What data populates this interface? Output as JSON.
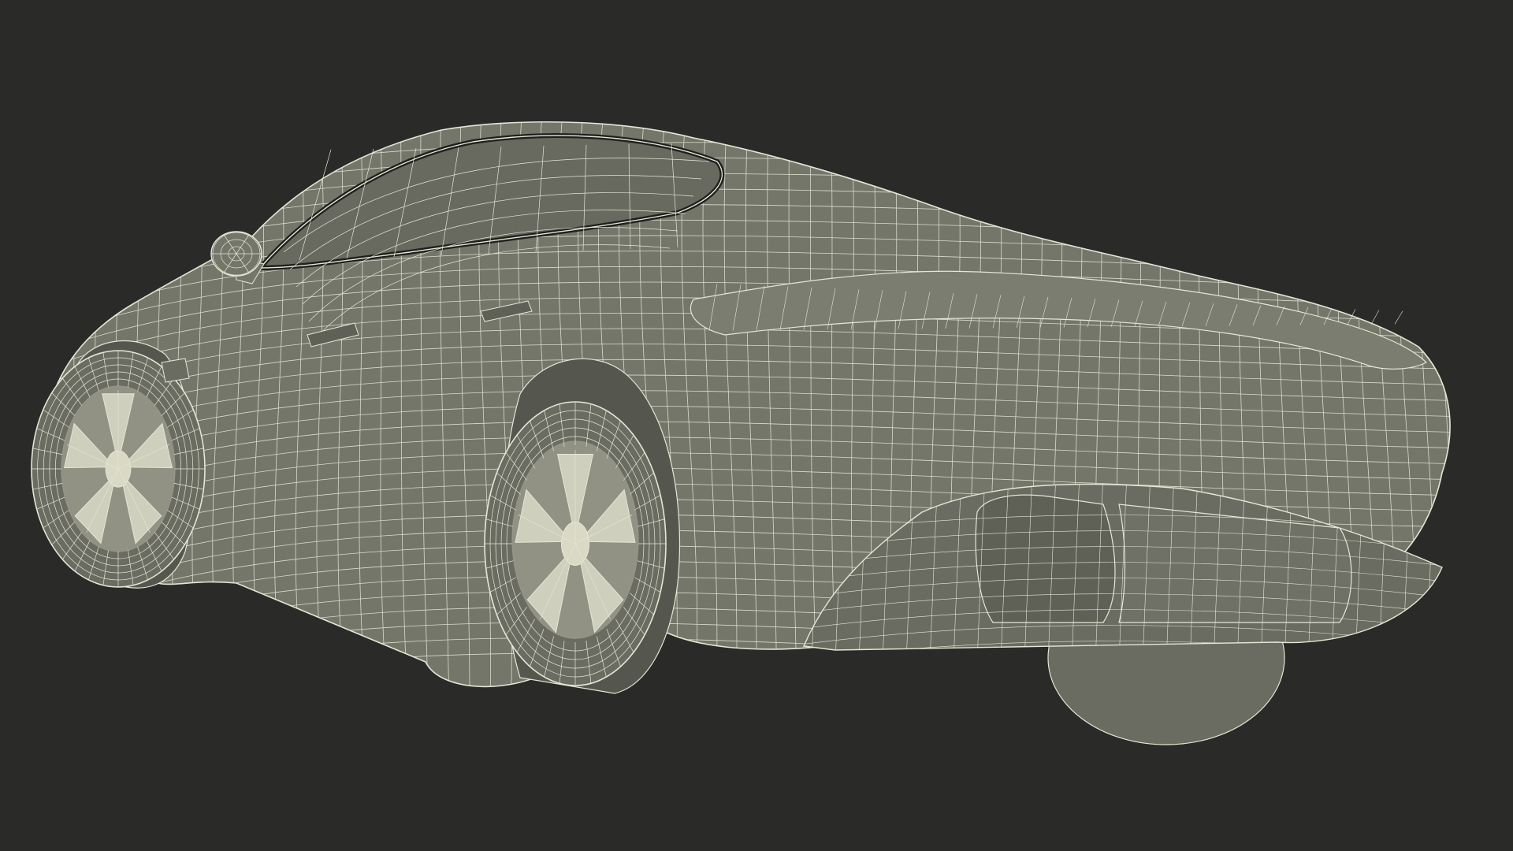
{
  "scene": {
    "subject": "car-wireframe-render",
    "colors": {
      "background": "#2a2a28",
      "body_fill": "#74766a",
      "body_shadow": "#5f6157",
      "body_light": "#888a7e",
      "wire": "#e6e6d6",
      "wire_dim": "#c9c9b8",
      "glass": "#686a5f",
      "wheel_fill": "#6a6c61",
      "rim_fill": "#d9d9c6"
    }
  }
}
